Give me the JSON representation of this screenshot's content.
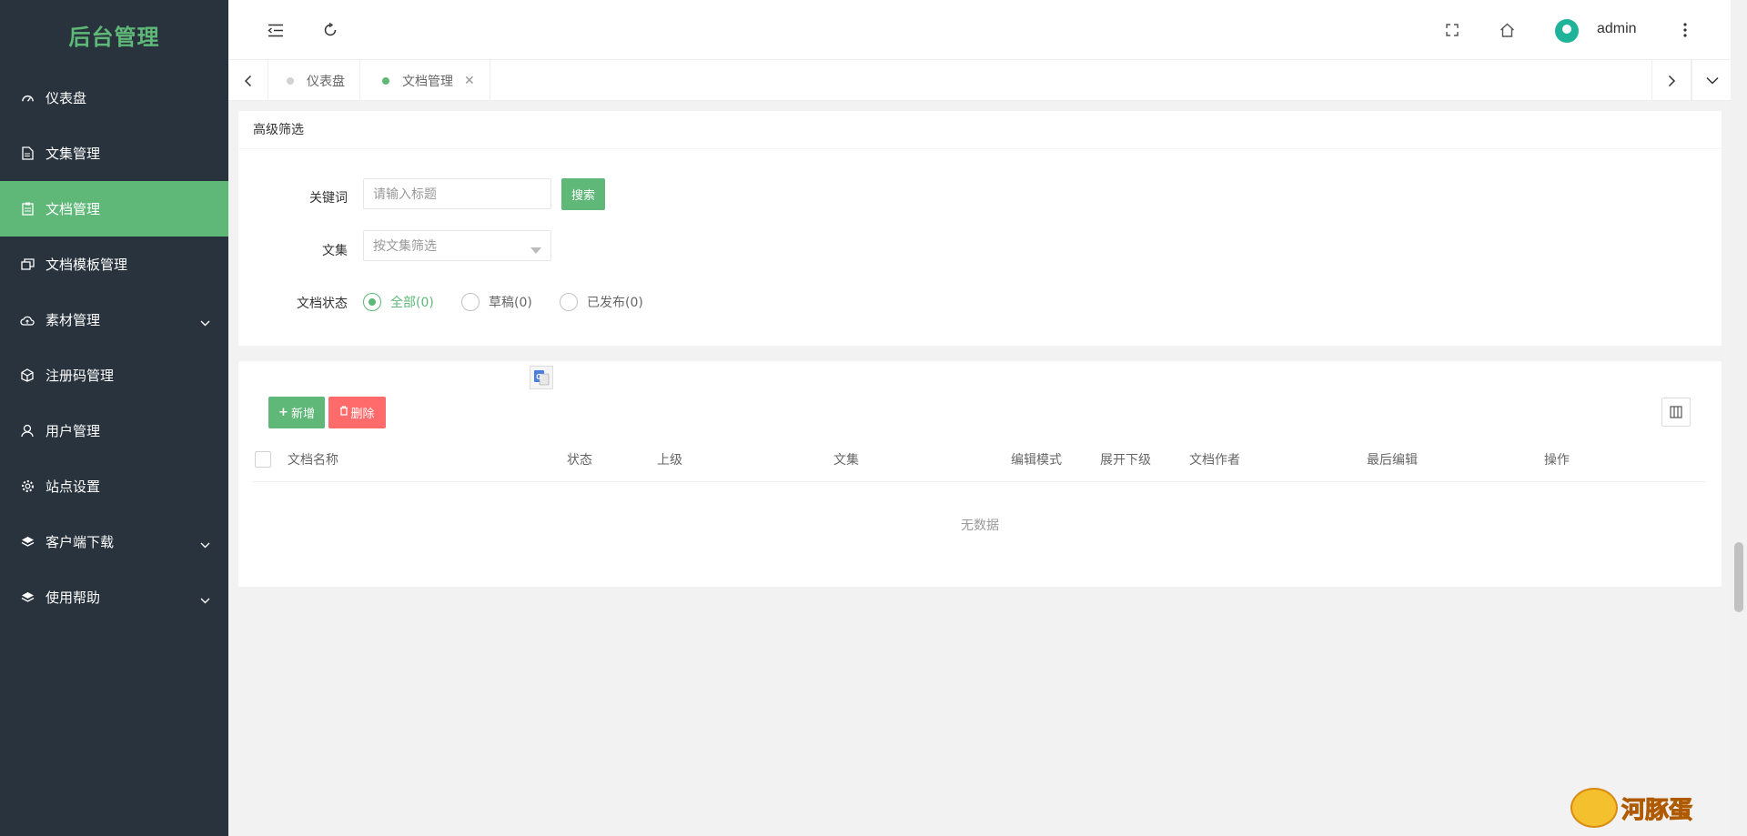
{
  "sidebar": {
    "logo": "后台管理",
    "items": [
      {
        "label": "仪表盘",
        "icon": "dashboard-icon"
      },
      {
        "label": "文集管理",
        "icon": "file-icon"
      },
      {
        "label": "文档管理",
        "icon": "document-icon",
        "active": true
      },
      {
        "label": "文档模板管理",
        "icon": "template-icon"
      },
      {
        "label": "素材管理",
        "icon": "cloud-icon",
        "has_children": true
      },
      {
        "label": "注册码管理",
        "icon": "cube-icon"
      },
      {
        "label": "用户管理",
        "icon": "user-icon"
      },
      {
        "label": "站点设置",
        "icon": "gear-icon"
      },
      {
        "label": "客户端下载",
        "icon": "layers-icon",
        "has_children": true
      },
      {
        "label": "使用帮助",
        "icon": "help-layers-icon",
        "has_children": true
      }
    ]
  },
  "header": {
    "username": "admin",
    "icons": [
      "menu-fold-icon",
      "refresh-icon",
      "fullscreen-icon",
      "home-icon",
      "more-vertical-icon"
    ]
  },
  "tabs": {
    "items": [
      {
        "label": "仪表盘",
        "active": false
      },
      {
        "label": "文档管理",
        "active": true,
        "closable": true
      }
    ]
  },
  "filter": {
    "title": "高级筛选",
    "keyword_label": "关键词",
    "keyword_placeholder": "请输入标题",
    "search_button": "搜索",
    "collection_label": "文集",
    "collection_placeholder": "按文集筛选",
    "status_label": "文档状态",
    "status_options": [
      {
        "label": "全部(0)",
        "checked": true
      },
      {
        "label": "草稿(0)",
        "checked": false
      },
      {
        "label": "已发布(0)",
        "checked": false
      }
    ]
  },
  "table": {
    "add_button": "新增",
    "delete_button": "删除",
    "columns": [
      "文档名称",
      "状态",
      "上级",
      "文集",
      "编辑模式",
      "展开下级",
      "文档作者",
      "最后编辑",
      "操作"
    ],
    "empty_text": "无数据"
  },
  "watermark": {
    "text": "河豚蛋"
  },
  "colors": {
    "sidebar_bg": "#28333e",
    "accent": "#5fb878",
    "danger": "#ff5722"
  }
}
